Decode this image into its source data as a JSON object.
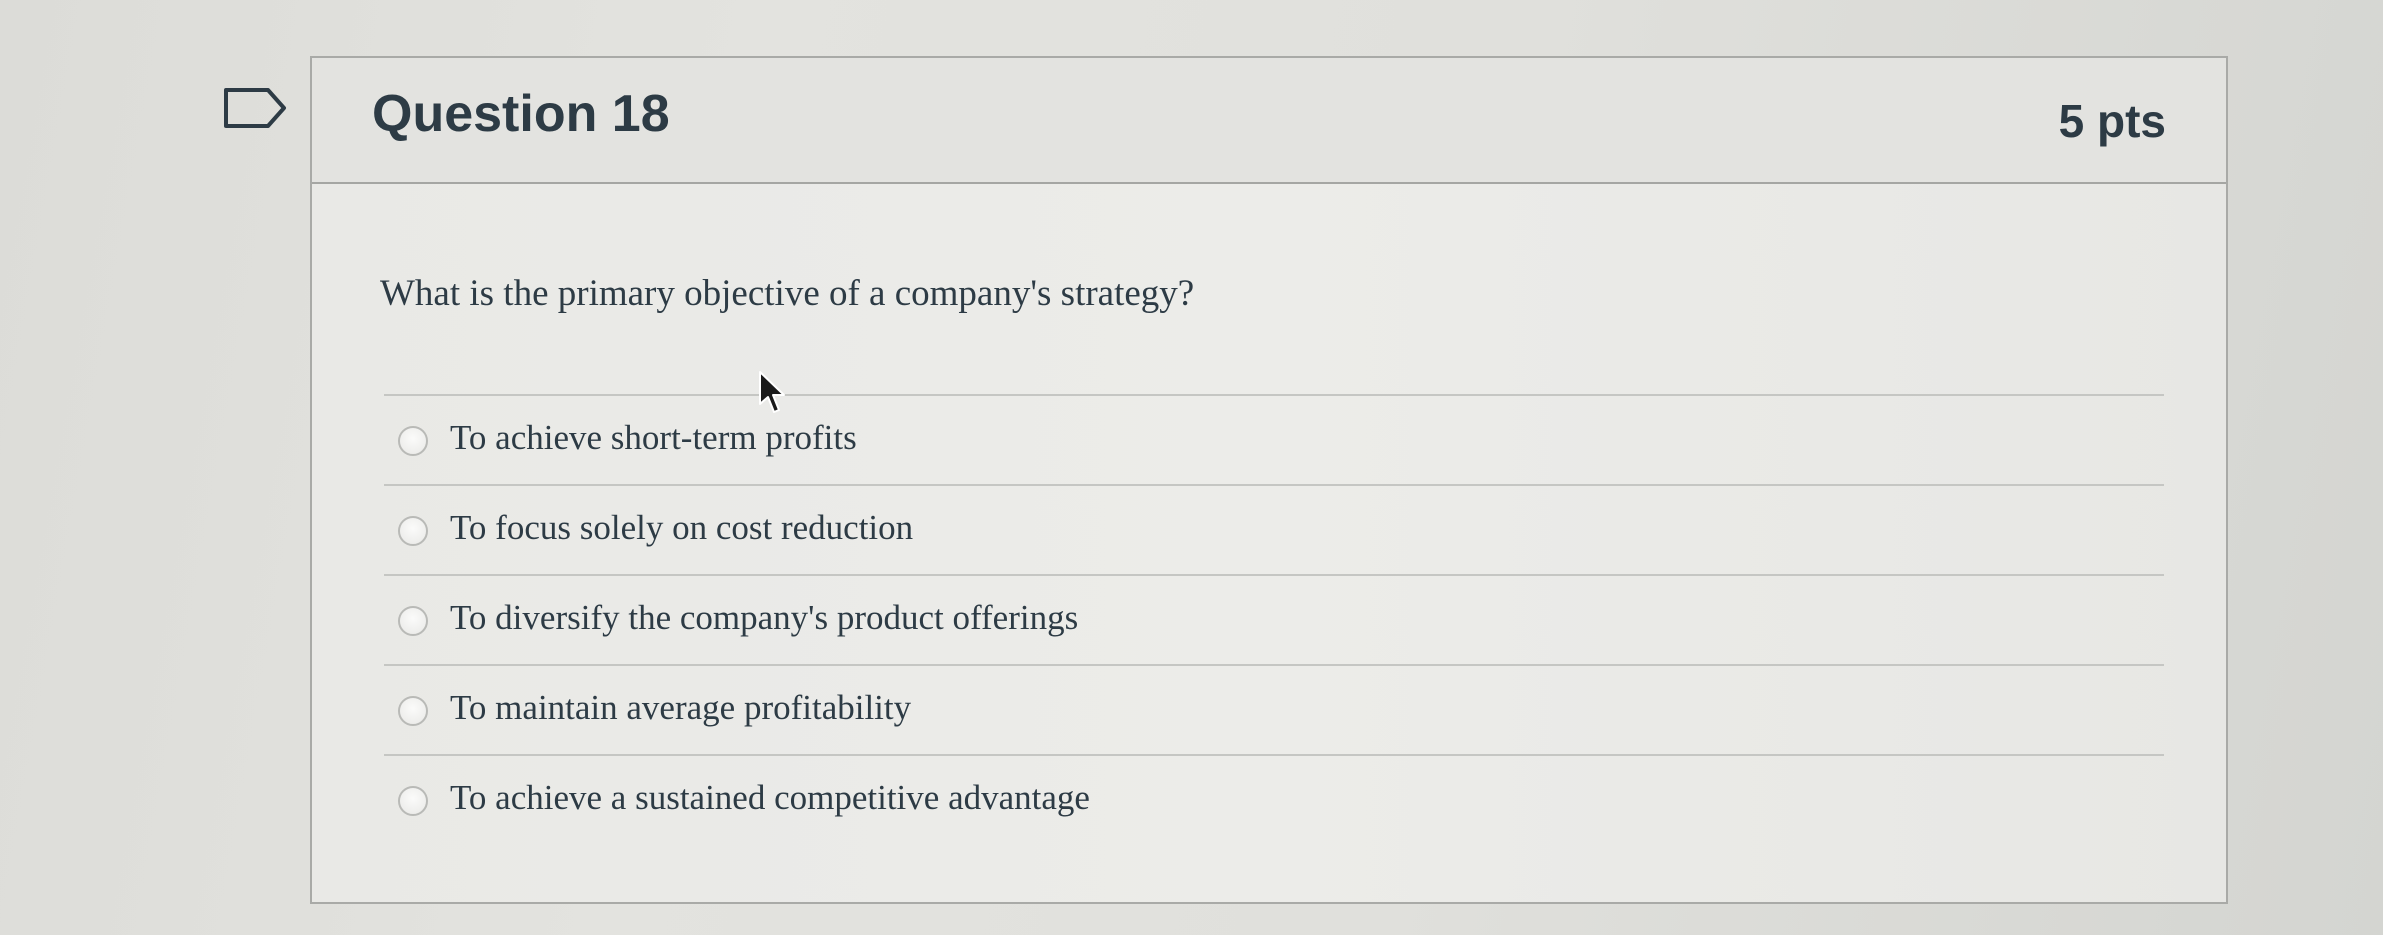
{
  "question": {
    "title": "Question 18",
    "points": "5 pts",
    "text": "What is the primary objective of a company's strategy?"
  },
  "answers": [
    {
      "label": "To achieve short-term profits",
      "selected": false
    },
    {
      "label": "To focus solely on cost reduction",
      "selected": false
    },
    {
      "label": "To diversify the company's product offerings",
      "selected": false
    },
    {
      "label": "To maintain average profitability",
      "selected": false
    },
    {
      "label": "To achieve a sustained competitive advantage",
      "selected": false
    }
  ],
  "icons": {
    "flag": "flag-icon",
    "cursor": "mouse-pointer-icon",
    "radio": "radio-button"
  },
  "colors": {
    "text": "#2d3b45",
    "border": "#a9aaa7"
  }
}
